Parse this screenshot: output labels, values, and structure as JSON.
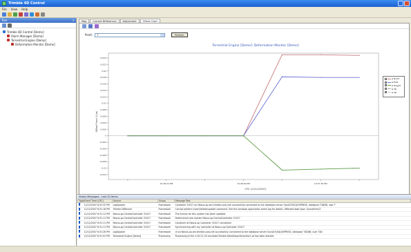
{
  "app": {
    "title": "Trimble 4D Control"
  },
  "menu": [
    "File",
    "View",
    "Help"
  ],
  "left_panel": {
    "title": "Tree",
    "tree": [
      {
        "label": "Trimble 4D Control [Demo]",
        "level": 0,
        "color": "#2e6fd1"
      },
      {
        "label": "Alarm Manager [Demo]",
        "level": 1,
        "color": "#c0302c"
      },
      {
        "label": "Terrestrial Engine [Demo]",
        "level": 1,
        "color": "#c0302c"
      },
      {
        "label": "Deformation Monitor [Demo]",
        "level": 2,
        "color": "#b83030"
      }
    ]
  },
  "tabs": [
    "Map",
    "Current Differences",
    "Adjustment",
    "Offset Chart"
  ],
  "active_tab": 3,
  "root": {
    "label": "Point:",
    "value": "7",
    "refresh_label": "Refresh"
  },
  "chart_data": {
    "type": "line",
    "title": "Terrestrial Engine [Demo]: Deformation Monitor [Demo]",
    "xlabel": "UTC (11/11/2007)",
    "ylabel": "Offset From 1 (m)",
    "x_ticks": [
      "10:33:36 PM",
      "10:38:24 PM",
      "10:43:12 PM",
      "10:48:00 PM",
      "10:52:48 PM",
      "10:57:36 PM",
      "11:02:24 PM"
    ],
    "y_ticks": [
      0.024,
      0.022,
      0.02,
      0.018,
      0.016,
      0.014,
      0.012,
      0.01,
      0.008,
      0.006,
      0.004,
      0.002,
      0,
      -0.002,
      -0.004,
      -0.006,
      -0.008,
      -0.01,
      -0.012
    ],
    "y_tick_labels": [
      "0.024",
      "0.022",
      "0.02",
      "0.018",
      "0.016",
      "0.014",
      "0.012",
      "0.01",
      "0.008",
      "0.006",
      "0.004",
      "0.002",
      "0",
      "-0.002",
      "-0.004",
      "-0.006",
      "-0.008",
      "-0.01",
      "-0.012"
    ],
    "ylim": [
      -0.0135,
      0.0255
    ],
    "series": [
      {
        "name": "Δ North",
        "color": "#c7787a",
        "values": [
          0,
          0,
          0,
          0,
          0.025,
          0.025,
          0.0248
        ]
      },
      {
        "name": "Δ East",
        "color": "#6b6fd4",
        "values": [
          0,
          0,
          0,
          0,
          0.0182,
          0.018,
          0.018
        ]
      },
      {
        "name": "Δ Height",
        "color": "#5a9a45",
        "values": [
          0,
          0,
          0,
          0,
          -0.0106,
          -0.0103,
          -0.01
        ]
      },
      {
        "name": "Δ 2D",
        "color": "#aaaaaa",
        "values": []
      },
      {
        "name": "Δ 3D",
        "color": "#cccccc",
        "values": []
      }
    ]
  },
  "status": {
    "title": "Status Messages - Last 20 Items",
    "columns": [
      "Type",
      "Event Time (UTC)",
      "Source",
      "Group",
      "Message Text"
    ],
    "rows": [
      [
        "",
        "11/12/2007 6:31:32 PM",
        "LogSpooler",
        "Framework",
        "Controller 31017 on Nexus-xp.am.trimble-corp.net successfully connected to the database server Uscal23\\SQLEXPRESS, database T4DDB, user T"
      ],
      [
        "",
        "11/12/2007 6:31:16 PM",
        "Trimble DBServer",
        "Framework",
        "Cannot perform insert/delete/update command. See the windows application event log for details. Affected data type: QueueEntry2"
      ],
      [
        "",
        "11/12/2007 6:31:11 PM",
        "Nexus-xp:CentralController 31017",
        "Framework",
        "The license for this system has been updated."
      ],
      [
        "",
        "11/12/2007 6:31:11 PM",
        "Nexus-xp:CentralController 31017",
        "Framework",
        "Determined new master Nexus-xp:CentralController 31017"
      ],
      [
        "",
        "11/12/2007 6:31:11 PM",
        "Nexus-xp:CentralController 31017",
        "Framework",
        "Container at Nexus-xp Container 31017 connected"
      ],
      [
        "",
        "11/12/2007 6:31:11 PM",
        "Nexus-xp:CentralController 31017",
        "Framework",
        "Synchronizing with my controller at Nexus-xp:Controller 31017"
      ],
      [
        "",
        "11/12/2007 6:31:26 PM",
        "LogSpooler",
        "Framework",
        "UI on Nexus-xp.am.trimble-corp.net successfully connected to the database server Uscal23\\SQLEXPRESS, database T4DDB, user T4D"
      ],
      [
        "",
        "11/12/2007 6:31:02 PM",
        "Terrestrial Engine [Demo]",
        "Processing",
        "Processing of the C:\\5C12-20 emulator\\Trimble Data\\Export\\monitor1.pt has been started."
      ]
    ]
  },
  "colors": {
    "accent": "#1b5fd1"
  }
}
